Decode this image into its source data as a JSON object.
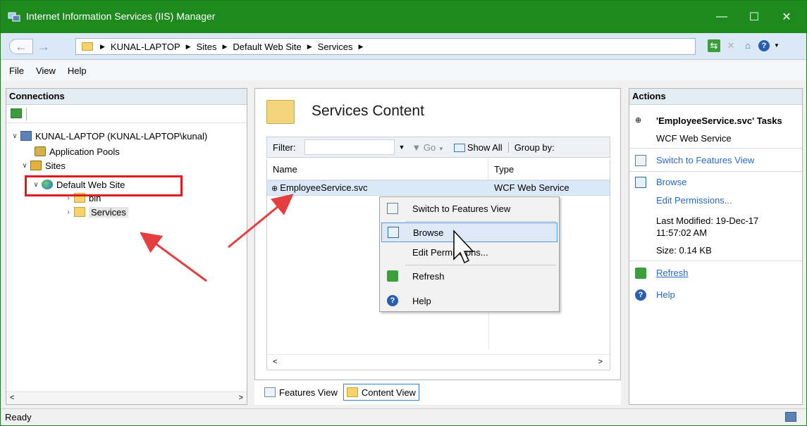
{
  "window": {
    "title": "Internet Information Services (IIS) Manager",
    "controls": {
      "minimize": "—",
      "maximize": "☐",
      "close": "✕"
    }
  },
  "address": {
    "crumbs": [
      "KUNAL-LAPTOP",
      "Sites",
      "Default Web Site",
      "Services"
    ]
  },
  "menu": {
    "items": [
      "File",
      "View",
      "Help"
    ]
  },
  "connections": {
    "header": "Connections",
    "tree": {
      "server": "KUNAL-LAPTOP (KUNAL-LAPTOP\\kunal)",
      "app_pools": "Application Pools",
      "sites": "Sites",
      "default_site": "Default Web Site",
      "bin": "bin",
      "services": "Services"
    }
  },
  "content": {
    "title": "Services Content",
    "filter_label": "Filter:",
    "go_label": "Go",
    "show_all_label": "Show All",
    "group_by_label": "Group by:",
    "columns": [
      "Name",
      "Type"
    ],
    "rows": [
      {
        "name": "EmployeeService.svc",
        "type": "WCF Web Service"
      }
    ],
    "view_tabs": {
      "features": "Features View",
      "content": "Content View"
    }
  },
  "context_menu": {
    "items": [
      {
        "label": "Switch to Features View",
        "icon": "features-view-icon"
      },
      {
        "label": "Browse",
        "icon": "browse-icon"
      },
      {
        "label": "Edit Permissions...",
        "icon": ""
      },
      {
        "label": "Refresh",
        "icon": "refresh-icon"
      },
      {
        "label": "Help",
        "icon": "help-icon"
      }
    ]
  },
  "actions": {
    "header": "Actions",
    "task_title": "'EmployeeService.svc' Tasks",
    "task_subtitle": "WCF Web Service",
    "switch_features": "Switch to Features View",
    "browse": "Browse",
    "edit_permissions": "Edit Permissions...",
    "last_modified_label": "Last Modified: 19-Dec-17",
    "last_modified_time": "11:57:02 AM",
    "size": "Size: 0.14 KB",
    "refresh": "Refresh",
    "help": "Help"
  },
  "status": {
    "text": "Ready"
  },
  "colors": {
    "titlebar": "#1d8a1d",
    "highlight": "#e01b1b",
    "link": "#2a6ac4",
    "selection": "#dbe8f6"
  }
}
